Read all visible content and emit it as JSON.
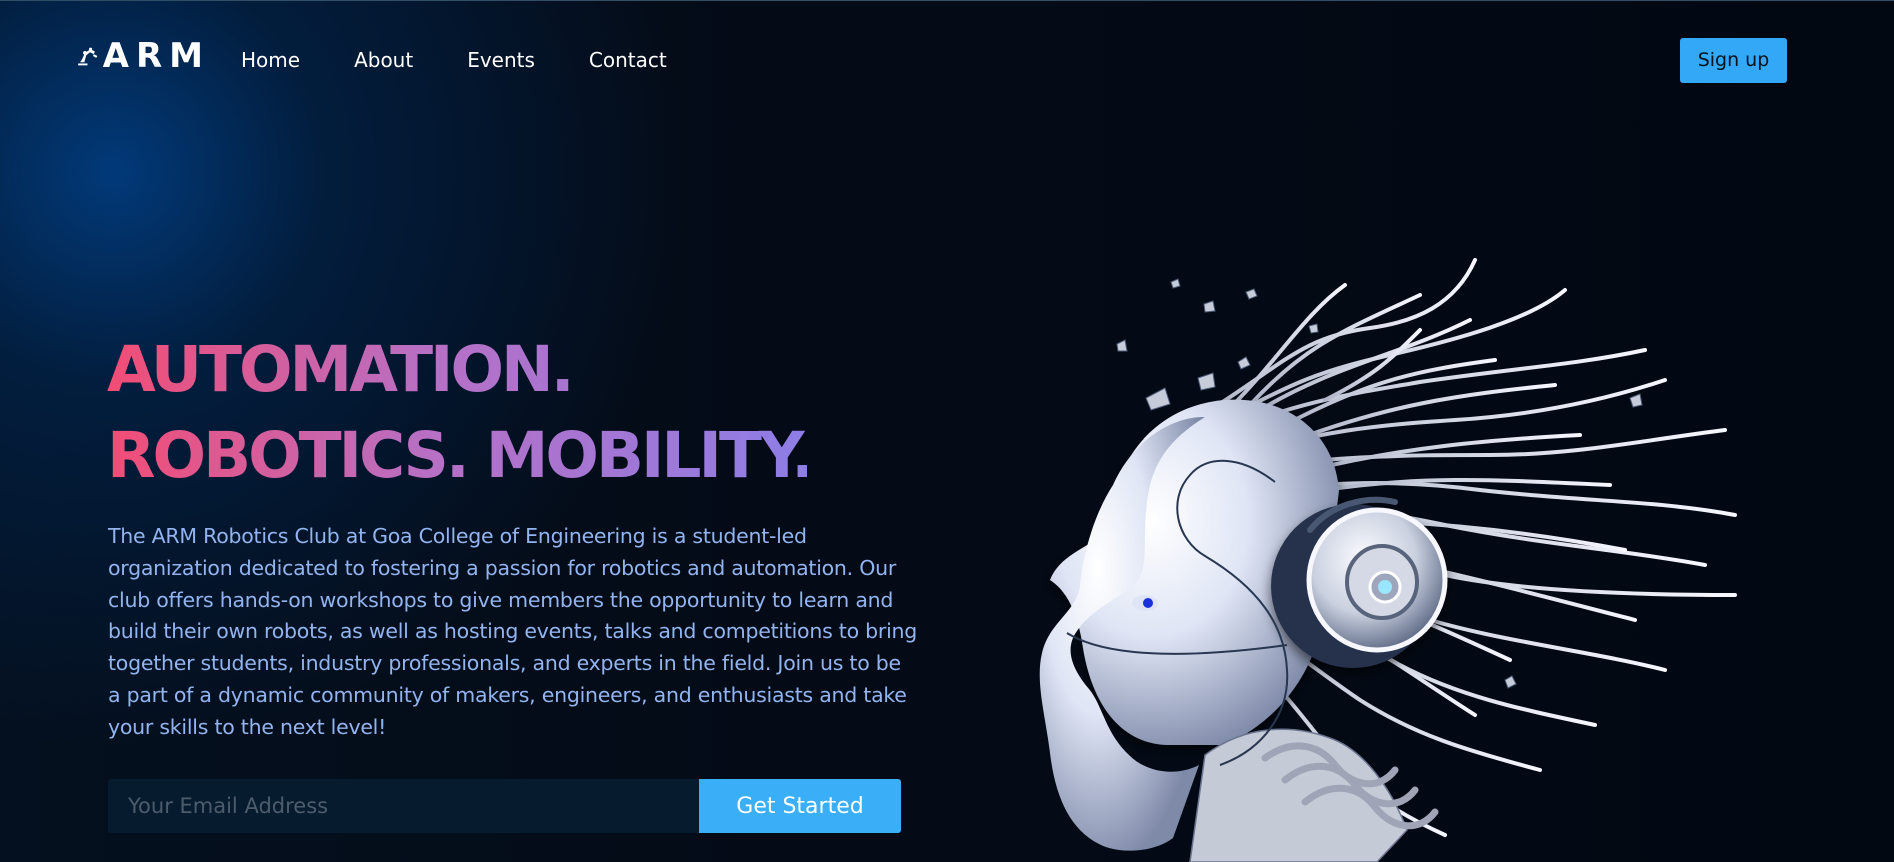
{
  "brand": {
    "logo_text": "ARM",
    "logo_icon": "robotic-arm-icon"
  },
  "nav": {
    "items": [
      "Home",
      "About",
      "Events",
      "Contact"
    ]
  },
  "header": {
    "signup_label": "Sign up"
  },
  "hero": {
    "title_lines": [
      "AUTOMATION.",
      "ROBOTICS. MOBILITY."
    ],
    "description": "The ARM Robotics Club at Goa College of Engineering is a student-led organization dedicated to fostering a passion for robotics and automation. Our club offers hands-on workshops to give members the opportunity to learn and build their own robots, as well as hosting events, talks and competitions to bring together students, industry professionals, and experts in the field. Join us to be a part of a dynamic community of makers, engineers, and enthusiasts and take your skills to the next level!",
    "email_placeholder": "Your Email Address",
    "cta_label": "Get Started"
  },
  "colors": {
    "background": "#040b16",
    "accent_blue": "#33a8f7",
    "gradient_pink": "#f24d75",
    "gradient_purple": "#8d7ee6",
    "description_blue": "#92b4f0"
  },
  "visual": {
    "robot_image": "robot-head-with-wires-illustration"
  }
}
